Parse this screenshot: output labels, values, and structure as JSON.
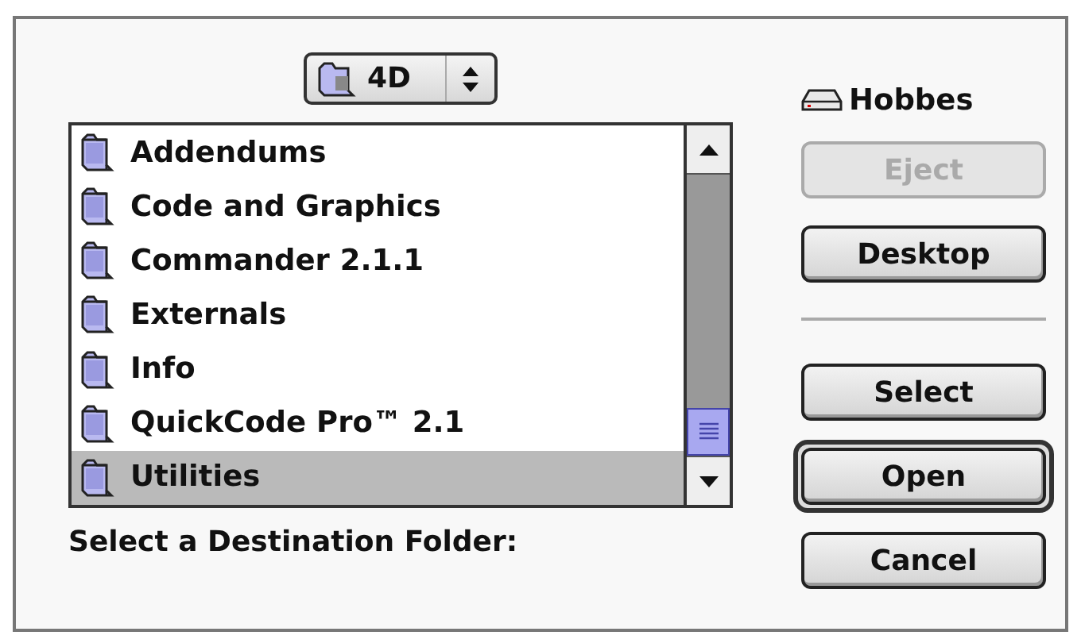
{
  "popup": {
    "label": "4D"
  },
  "files": [
    {
      "name": "Addendums",
      "selected": false
    },
    {
      "name": "Code and Graphics",
      "selected": false
    },
    {
      "name": "Commander 2.1.1",
      "selected": false
    },
    {
      "name": "Externals",
      "selected": false
    },
    {
      "name": "Info",
      "selected": false
    },
    {
      "name": "QuickCode Pro™ 2.1",
      "selected": false
    },
    {
      "name": "Utilities",
      "selected": true
    }
  ],
  "prompt": "Select a Destination Folder:",
  "volume": {
    "name": "Hobbes"
  },
  "volume_buttons": [
    {
      "label": "Eject",
      "disabled": true,
      "default": false
    },
    {
      "label": "Desktop",
      "disabled": false,
      "default": false
    }
  ],
  "action_buttons": [
    {
      "label": "Select",
      "disabled": false,
      "default": false
    },
    {
      "label": "Open",
      "disabled": false,
      "default": true
    },
    {
      "label": "Cancel",
      "disabled": false,
      "default": false
    }
  ]
}
